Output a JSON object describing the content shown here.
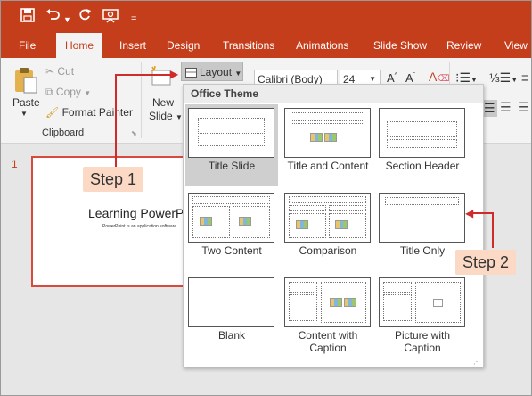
{
  "ribbon_tabs": [
    "File",
    "Home",
    "Insert",
    "Design",
    "Transitions",
    "Animations",
    "Slide Show",
    "Review",
    "View"
  ],
  "clipboard": {
    "paste": "Paste",
    "cut": "Cut",
    "copy": "Copy",
    "format_painter": "Format Painter",
    "group_label": "Clipboard"
  },
  "slides": {
    "new_slide_line1": "New",
    "new_slide_line2": "Slide",
    "layout_button": "Layout"
  },
  "font": {
    "family": "Calibri (Body)",
    "size": "24"
  },
  "gallery": {
    "header": "Office Theme",
    "layouts": [
      {
        "label": "Title Slide",
        "selected": true
      },
      {
        "label": "Title and Content"
      },
      {
        "label": "Section Header"
      },
      {
        "label": "Two Content"
      },
      {
        "label": "Comparison"
      },
      {
        "label": "Title Only"
      },
      {
        "label": "Blank"
      },
      {
        "label": "Content with Caption"
      },
      {
        "label": "Picture with Caption"
      }
    ]
  },
  "slide": {
    "number": "1",
    "title": "Learning PowerPo",
    "subtitle": "PowerPoint is an application software"
  },
  "callouts": {
    "step1": "Step 1",
    "step2": "Step 2"
  },
  "colors": {
    "accent": "#c43e1c",
    "callout_bg": "#fbd9c5",
    "callout_line": "#d02b2b"
  }
}
